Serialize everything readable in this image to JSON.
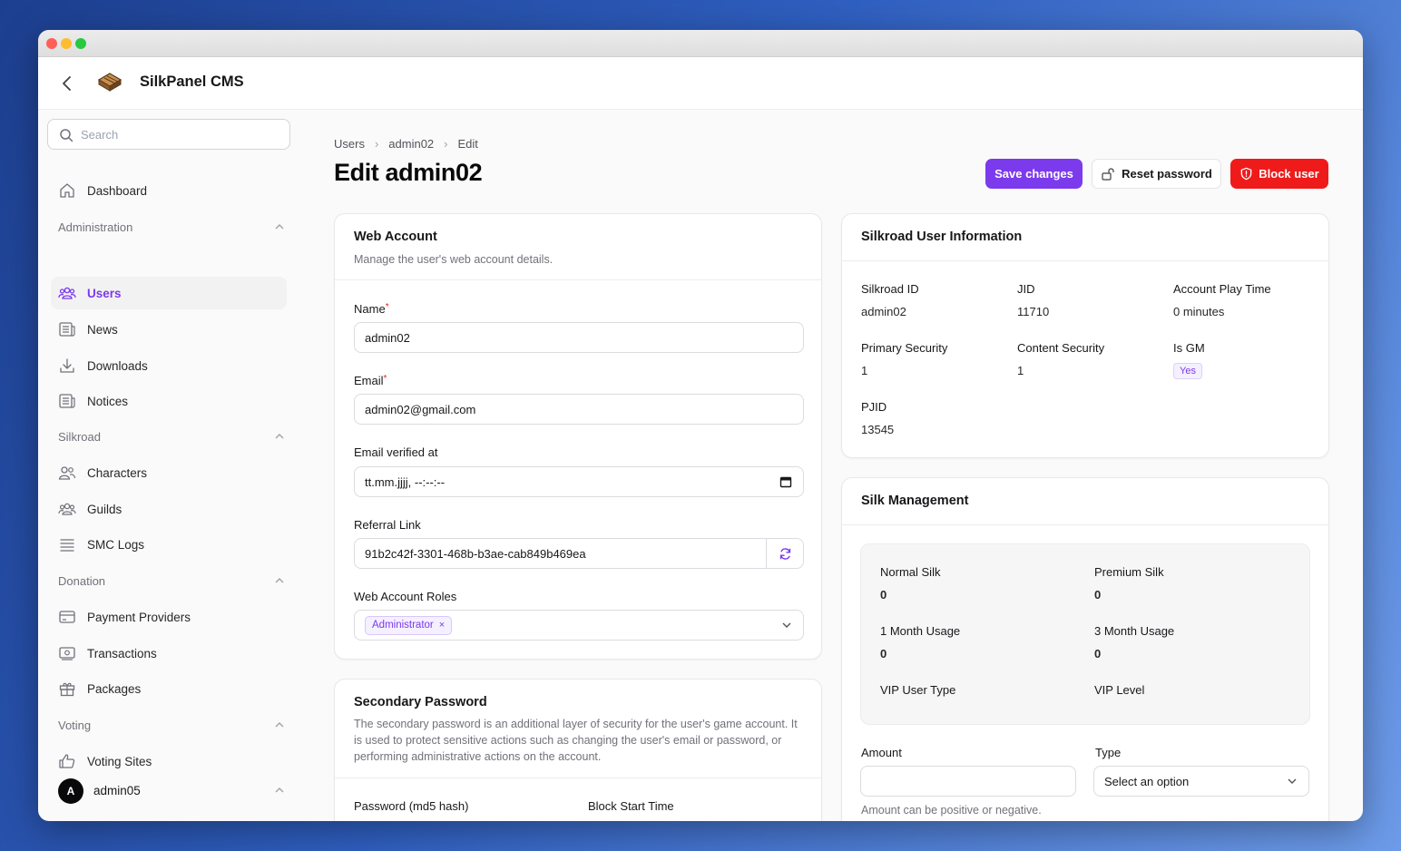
{
  "app": {
    "title": "SilkPanel CMS"
  },
  "sidebar": {
    "search_placeholder": "Search",
    "dashboard": "Dashboard",
    "groups": {
      "administration": "Administration",
      "silkroad": "Silkroad",
      "donation": "Donation",
      "voting": "Voting"
    },
    "items": {
      "users": "Users",
      "news": "News",
      "downloads": "Downloads",
      "notices": "Notices",
      "characters": "Characters",
      "guilds": "Guilds",
      "smc_logs": "SMC Logs",
      "payment_providers": "Payment Providers",
      "transactions": "Transactions",
      "packages": "Packages",
      "voting_sites": "Voting Sites"
    },
    "user": {
      "initial": "A",
      "name": "admin05"
    }
  },
  "breadcrumb": [
    "Users",
    "admin02",
    "Edit"
  ],
  "page_title": "Edit admin02",
  "actions": {
    "save": "Save changes",
    "reset_password": "Reset password",
    "block_user": "Block user"
  },
  "web_account": {
    "title": "Web Account",
    "description": "Manage the user's web account details.",
    "name_label": "Name",
    "name_value": "admin02",
    "email_label": "Email",
    "email_value": "admin02@gmail.com",
    "verified_label": "Email verified at",
    "verified_value": "tt.mm.jjjj, --:--:--",
    "referral_label": "Referral Link",
    "referral_value": "91b2c42f-3301-468b-b3ae-cab849b469ea",
    "roles_label": "Web Account Roles",
    "roles": [
      "Administrator"
    ],
    "required_mark": "*"
  },
  "secondary_password": {
    "title": "Secondary Password",
    "description": "The secondary password is an additional layer of security for the user's game account. It is used to protect sensitive actions such as changing the user's email or password, or performing administrative actions on the account.",
    "hash_label": "Password (md5 hash)",
    "block_start_label": "Block Start Time"
  },
  "silkroad_info": {
    "title": "Silkroad User Information",
    "silkroad_id_label": "Silkroad ID",
    "silkroad_id": "admin02",
    "jid_label": "JID",
    "jid": "11710",
    "play_time_label": "Account Play Time",
    "play_time": "0 minutes",
    "primary_security_label": "Primary Security",
    "primary_security": "1",
    "content_security_label": "Content Security",
    "content_security": "1",
    "is_gm_label": "Is GM",
    "is_gm": "Yes",
    "pjid_label": "PJID",
    "pjid": "13545"
  },
  "silk": {
    "title": "Silk Management",
    "normal_label": "Normal Silk",
    "normal": "0",
    "premium_label": "Premium Silk",
    "premium": "0",
    "month1_label": "1 Month Usage",
    "month1": "0",
    "month3_label": "3 Month Usage",
    "month3": "0",
    "vip_type_label": "VIP User Type",
    "vip_level_label": "VIP Level",
    "amount_label": "Amount",
    "amount_value": "",
    "type_label": "Type",
    "type_placeholder": "Select an option",
    "amount_hint": "Amount can be positive or negative."
  },
  "colors": {
    "accent": "#7c3aed",
    "danger": "#ef1b1b"
  }
}
